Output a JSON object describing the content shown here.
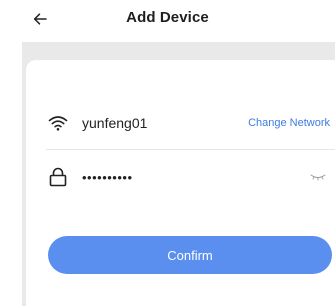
{
  "header": {
    "title": "Add Device",
    "back_icon": "arrow-left-icon"
  },
  "network": {
    "wifi_icon": "wifi-icon",
    "ssid": "yunfeng01",
    "change_label": "Change Network"
  },
  "password": {
    "lock_icon": "lock-icon",
    "value": "••••••••••",
    "visibility_icon": "eye-closed-icon"
  },
  "confirm": {
    "label": "Confirm"
  },
  "colors": {
    "accent": "#3d7ce0",
    "button": "#5a8ff0",
    "backdrop": "#e9e9e9"
  }
}
